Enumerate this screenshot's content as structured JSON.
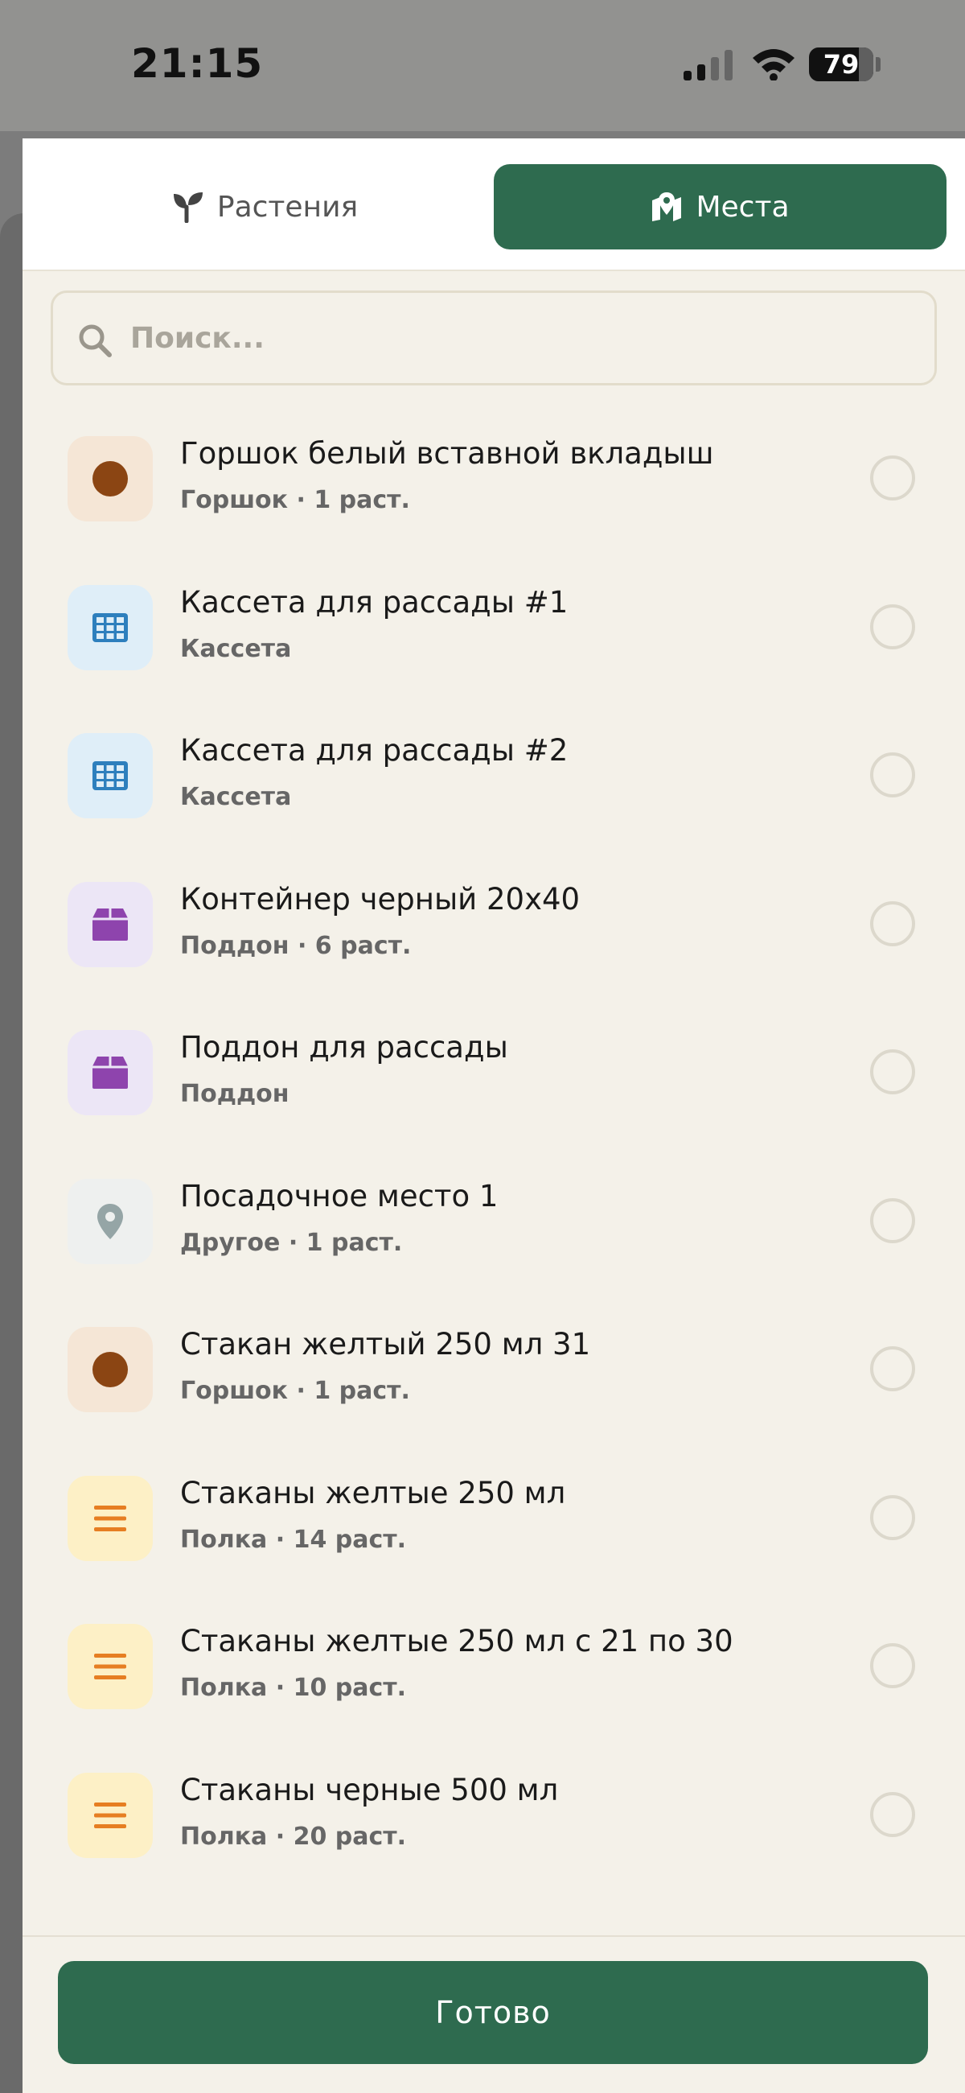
{
  "status_bar": {
    "time": "21:15",
    "battery": "79"
  },
  "tabs": [
    {
      "label": "Растения",
      "icon": "sprout-icon",
      "active": false
    },
    {
      "label": "Места",
      "icon": "map-pin-icon",
      "active": true
    }
  ],
  "search": {
    "placeholder": "Поиск...",
    "value": ""
  },
  "places": [
    {
      "title": "Горшок белый вставной вкладыш",
      "subtitle": "Горшок · 1 раст.",
      "icon": "pot-icon",
      "icon_color": "#8b4513",
      "icon_bg": "#f5e6d6"
    },
    {
      "title": "Кассета для рассады #1",
      "subtitle": "Кассета",
      "icon": "grid-icon",
      "icon_color": "#2e7fbd",
      "icon_bg": "#dfeef8"
    },
    {
      "title": "Кассета для рассады #2",
      "subtitle": "Кассета",
      "icon": "grid-icon",
      "icon_color": "#2e7fbd",
      "icon_bg": "#dfeef8"
    },
    {
      "title": "Контейнер черный 20х40",
      "subtitle": "Поддон · 6 раст.",
      "icon": "box-icon",
      "icon_color": "#8e44ad",
      "icon_bg": "#ece6f6"
    },
    {
      "title": "Поддон для рассады",
      "subtitle": "Поддон",
      "icon": "box-icon",
      "icon_color": "#8e44ad",
      "icon_bg": "#ece6f6"
    },
    {
      "title": "Посадочное место 1",
      "subtitle": "Другое · 1 раст.",
      "icon": "location-pin-icon",
      "icon_color": "#95a5a6",
      "icon_bg": "#eef0ef"
    },
    {
      "title": "Стакан желтый 250 мл 31",
      "subtitle": "Горшок · 1 раст.",
      "icon": "pot-icon",
      "icon_color": "#8b4513",
      "icon_bg": "#f5e6d6"
    },
    {
      "title": "Стаканы желтые 250 мл",
      "subtitle": "Полка · 14 раст.",
      "icon": "shelf-icon",
      "icon_color": "#e67e22",
      "icon_bg": "#fdf0c6"
    },
    {
      "title": "Стаканы желтые 250 мл с 21 по 30",
      "subtitle": "Полка · 10 раст.",
      "icon": "shelf-icon",
      "icon_color": "#e67e22",
      "icon_bg": "#fdf0c6"
    },
    {
      "title": "Стаканы черные 500 мл",
      "subtitle": "Полка · 20 раст.",
      "icon": "shelf-icon",
      "icon_color": "#e67e22",
      "icon_bg": "#fdf0c6"
    }
  ],
  "footer": {
    "done_label": "Готово"
  },
  "colors": {
    "accent": "#2e6b4f",
    "background": "#f4f1e9"
  }
}
